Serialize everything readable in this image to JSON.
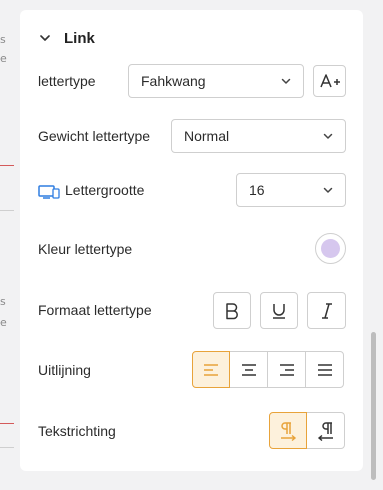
{
  "section": {
    "title": "Link"
  },
  "rows": {
    "font_family": {
      "label": "lettertype",
      "value": "Fahkwang"
    },
    "font_weight": {
      "label": "Gewicht lettertype",
      "value": "Normal"
    },
    "font_size": {
      "label": "Lettergrootte",
      "value": "16"
    },
    "font_color": {
      "label": "Kleur lettertype",
      "color": "#d6c7ee"
    },
    "font_format": {
      "label": "Formaat lettertype",
      "buttons": [
        "bold-icon",
        "underline-icon",
        "italic-icon"
      ]
    },
    "alignment": {
      "label": "Uitlijning",
      "buttons": [
        "align-left-icon",
        "align-center-icon",
        "align-right-icon",
        "align-justify-icon"
      ],
      "selected": "align-left-icon"
    },
    "direction": {
      "label": "Tekstrichting",
      "buttons": [
        "ltr-icon",
        "rtl-icon"
      ],
      "selected": "ltr-icon"
    }
  },
  "colors": {
    "accent": "#e8a33a",
    "accent_bg": "#fdf1dc",
    "device_icon": "#2f7de1"
  }
}
